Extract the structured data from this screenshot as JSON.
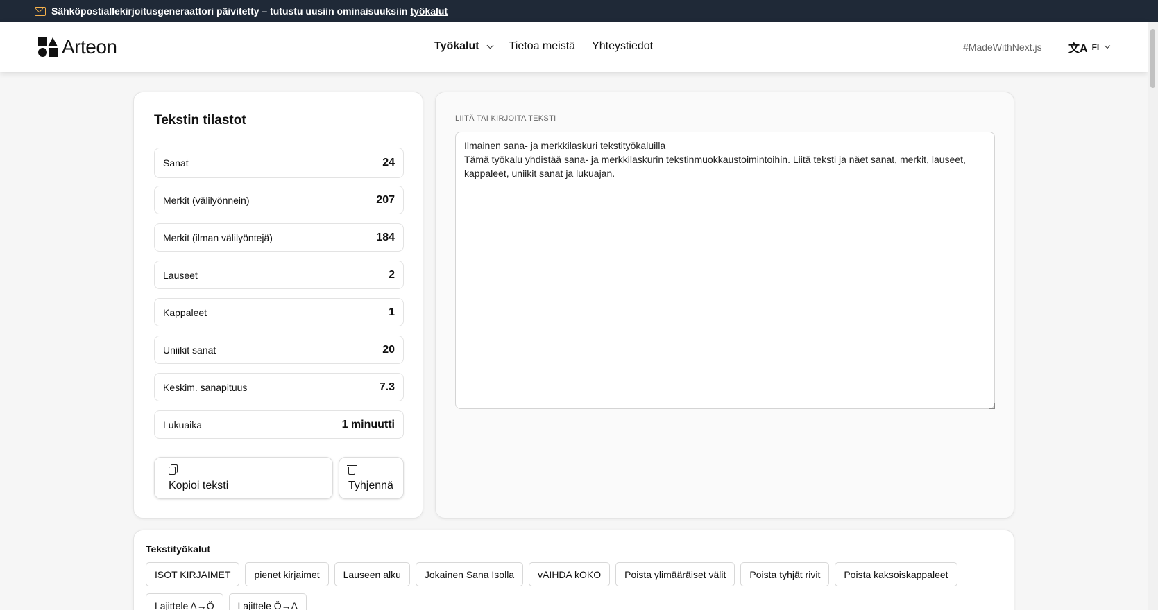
{
  "banner": {
    "text": "Sähköpostiallekirjoitusgeneraattori päivitetty – tutustu uusiin ominaisuuksiin",
    "link": "työkalut",
    "icon": "mail-icon",
    "icon_color": "#f5b14c"
  },
  "header": {
    "logo_text": "Arteon",
    "nav": {
      "tools": "Työkalut",
      "about": "Tietoa meistä",
      "contact": "Yhteystiedot"
    },
    "made_with": "#MadeWithNext.js",
    "lang_icon": "文A",
    "lang": "FI"
  },
  "stats": {
    "title": "Tekstin tilastot",
    "rows": [
      {
        "label": "Sanat",
        "value": "24"
      },
      {
        "label": "Merkit (välilyönnein)",
        "value": "207"
      },
      {
        "label": "Merkit (ilman välilyöntejä)",
        "value": "184"
      },
      {
        "label": "Lauseet",
        "value": "2"
      },
      {
        "label": "Kappaleet",
        "value": "1"
      },
      {
        "label": "Uniikit sanat",
        "value": "20"
      },
      {
        "label": "Keskim. sanapituus",
        "value": "7.3"
      },
      {
        "label": "Lukuaika",
        "value": "1 minuutti"
      }
    ],
    "copy_label": "Kopioi teksti",
    "clear_label": "Tyhjennä"
  },
  "editor": {
    "label": "LIITÄ TAI KIRJOITA TEKSTI",
    "value": "Ilmainen sana- ja merkkilaskuri tekstityökaluilla\nTämä työkalu yhdistää sana- ja merkkilaskurin tekstinmuokkaustoimintoihin. Liitä teksti ja näet sanat, merkit, lauseet, kappaleet, uniikit sanat ja lukuajan."
  },
  "tools": {
    "title": "Tekstityökalut",
    "buttons": [
      "ISOT KIRJAIMET",
      "pienet kirjaimet",
      "Lauseen alku",
      "Jokainen Sana Isolla",
      "vAIHDA kOKO",
      "Poista ylimääräiset välit",
      "Poista tyhjät rivit",
      "Poista kaksoiskappaleet",
      "Lajittele A→Ö",
      "Lajittele Ö→A"
    ]
  }
}
